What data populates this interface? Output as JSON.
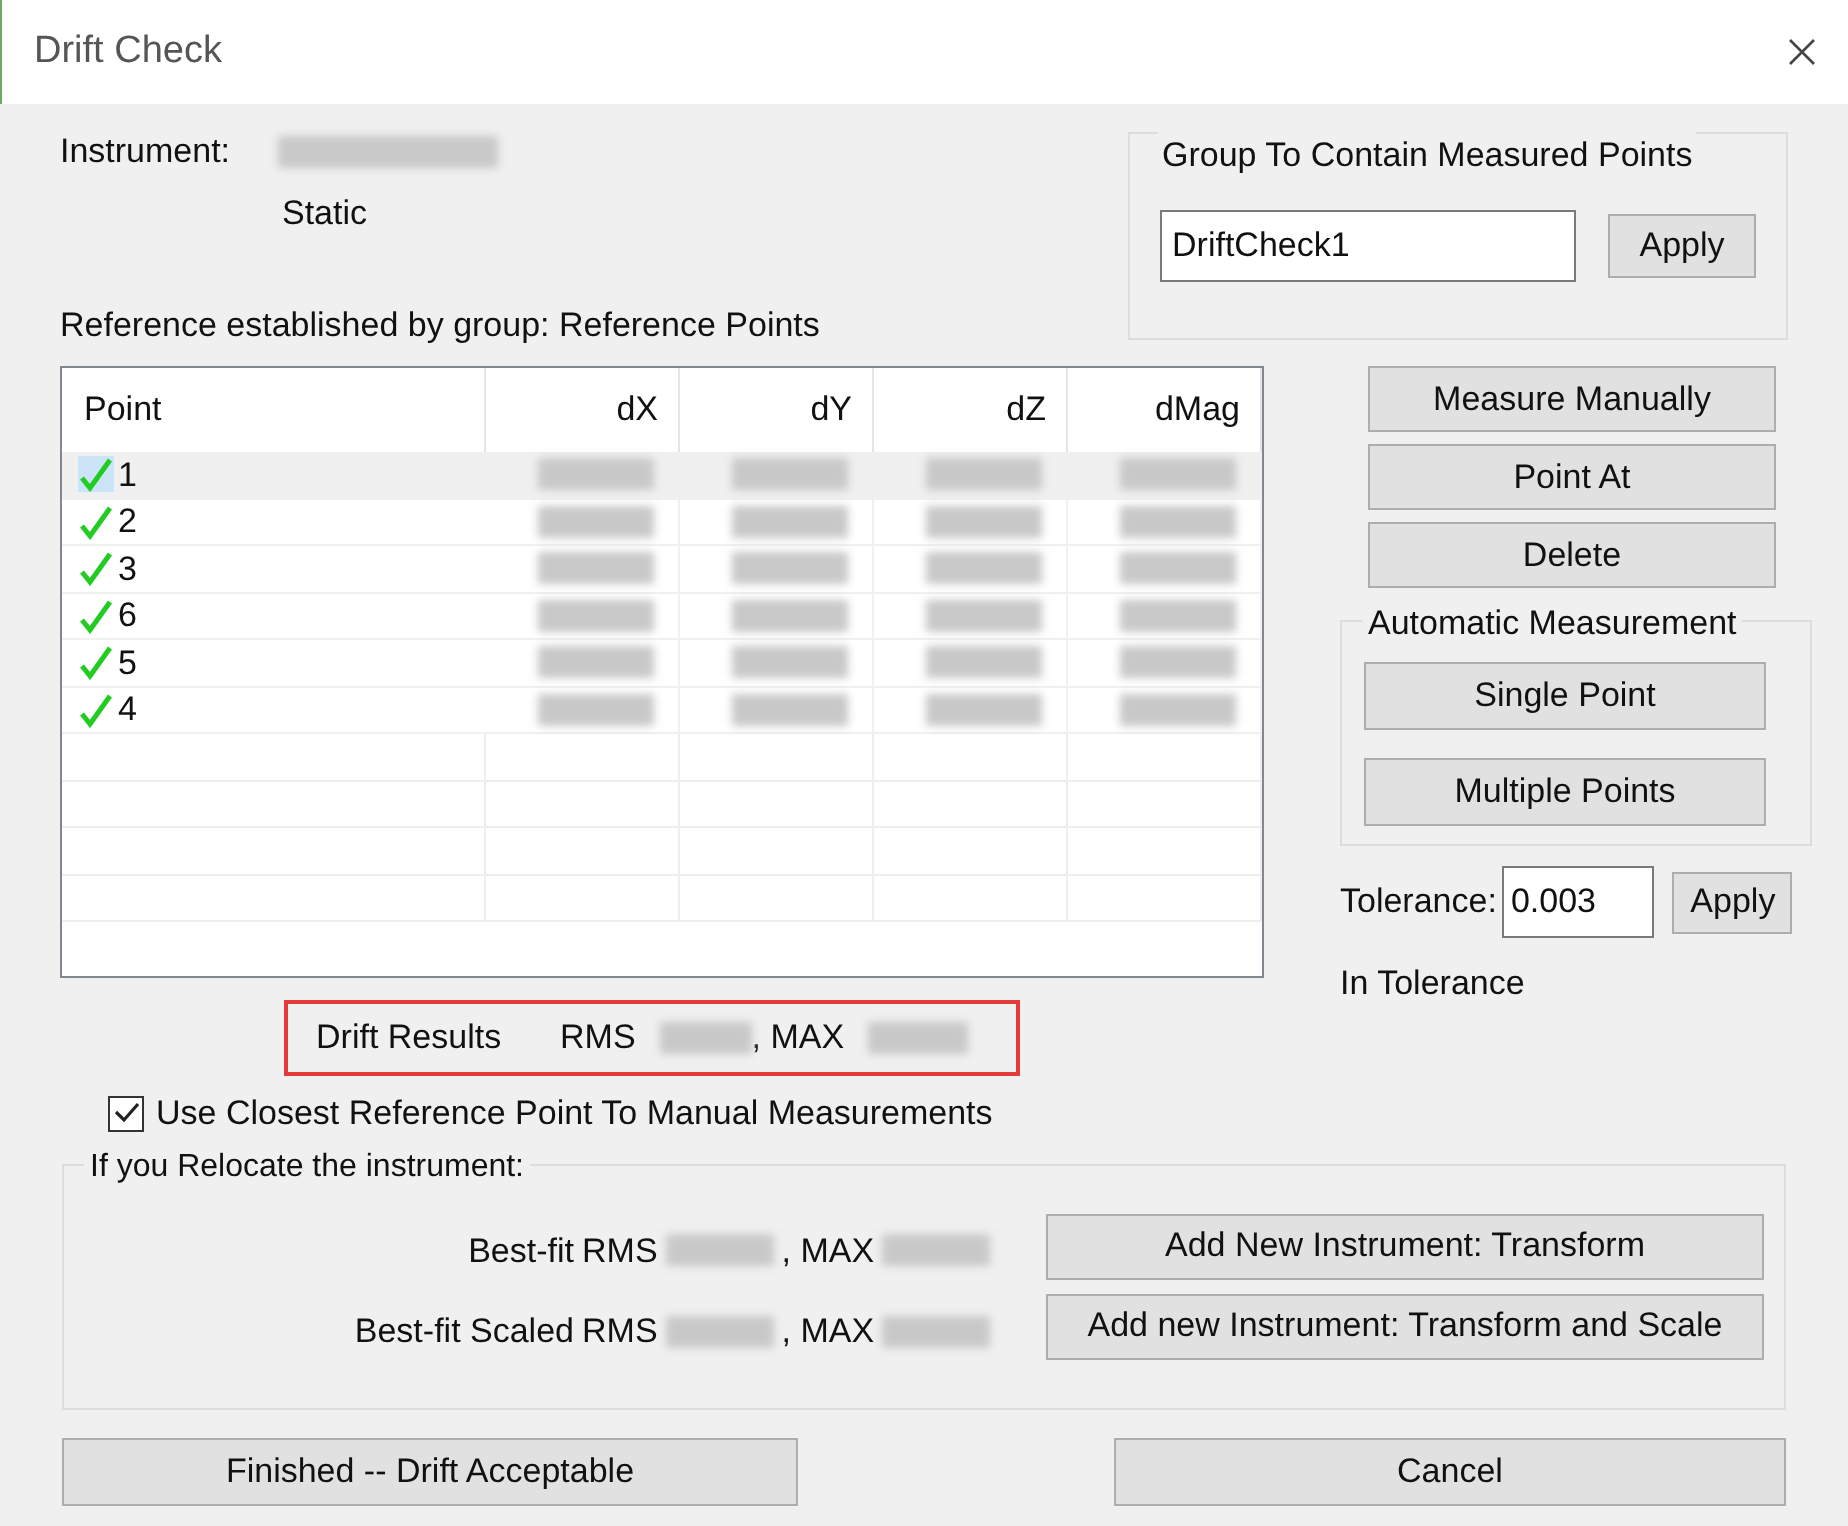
{
  "window": {
    "title": "Drift Check"
  },
  "instrument": {
    "label": "Instrument:",
    "mode": "Static"
  },
  "reference_text": "Reference established by group: Reference Points",
  "group_box": {
    "title": "Group To Contain Measured Points",
    "value": "DriftCheck1",
    "button": "Apply"
  },
  "table": {
    "columns": [
      "Point",
      "dX",
      "dY",
      "dZ",
      "dMag"
    ],
    "rows": [
      {
        "point": "1",
        "checked": true,
        "selected": true
      },
      {
        "point": "2",
        "checked": true,
        "selected": false
      },
      {
        "point": "3",
        "checked": true,
        "selected": false
      },
      {
        "point": "6",
        "checked": true,
        "selected": false
      },
      {
        "point": "5",
        "checked": true,
        "selected": false
      },
      {
        "point": "4",
        "checked": true,
        "selected": false
      }
    ]
  },
  "side_buttons": [
    "Measure Manually",
    "Point At",
    "Delete"
  ],
  "automatic": {
    "title": "Automatic Measurement",
    "buttons": [
      "Single Point",
      "Multiple Points"
    ]
  },
  "tolerance": {
    "label": "Tolerance:",
    "value": "0.003",
    "button": "Apply",
    "status": "In Tolerance"
  },
  "drift_results": {
    "label": "Drift Results",
    "rms": "RMS",
    "max": ", MAX"
  },
  "closest_reference": {
    "label": "Use Closest Reference Point To Manual Measurements",
    "checked": true
  },
  "relocate": {
    "title": "If you Relocate the instrument:",
    "rows": [
      {
        "label": "Best-fit",
        "rms": "RMS",
        "max": ", MAX"
      },
      {
        "label": "Best-fit Scaled",
        "rms": "RMS",
        "max": ", MAX"
      }
    ],
    "buttons": [
      "Add New Instrument: Transform",
      "Add new Instrument: Transform and Scale"
    ]
  },
  "footer_buttons": [
    "Finished -- Drift Acceptable",
    "Cancel"
  ]
}
